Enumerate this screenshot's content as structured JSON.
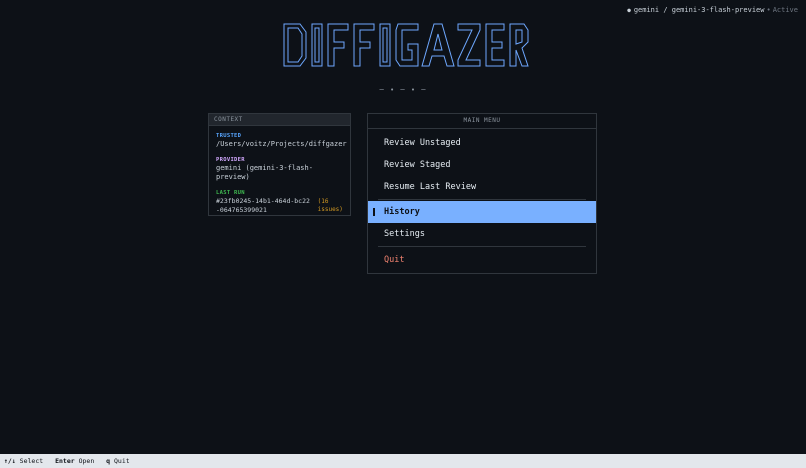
{
  "status": {
    "provider_line": "gemini / gemini-3-flash-preview",
    "separator": "•",
    "state": "Active"
  },
  "app": {
    "logo_text": "DIFFGAZER",
    "tagline": "─ • ─ • ─"
  },
  "context": {
    "heading": "CONTEXT",
    "trusted_label": "TRUSTED",
    "trusted_value": "/Users/voitz/Projects/diffgazer",
    "provider_label": "PROVIDER",
    "provider_value": "gemini (gemini-3-flash-preview)",
    "last_run_label": "LAST RUN",
    "last_run_id": "#23fb0245-14b1-464d-bc22-064765399021",
    "last_run_issues": "(16 issues)"
  },
  "menu": {
    "heading": "MAIN MENU",
    "items": [
      {
        "label": "Review Unstaged"
      },
      {
        "label": "Review Staged"
      },
      {
        "label": "Resume Last Review"
      },
      {
        "label": "History"
      },
      {
        "label": "Settings"
      },
      {
        "label": "Quit"
      }
    ],
    "selected_index": 3
  },
  "footer": {
    "hints": [
      {
        "key": "↑/↓",
        "label": "Select"
      },
      {
        "key": "Enter",
        "label": "Open"
      },
      {
        "key": "q",
        "label": "Quit"
      }
    ]
  },
  "colors": {
    "background": "#0d1117",
    "accent": "#79b0ff",
    "trusted": "#58a6ff",
    "provider": "#d2a8ff",
    "last_run": "#3fb950",
    "issues": "#d29922",
    "quit": "#f0826f"
  }
}
